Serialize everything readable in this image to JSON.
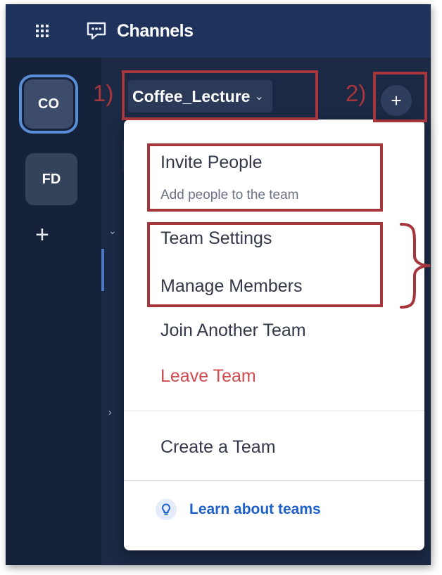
{
  "header": {
    "title": "Channels",
    "grid_icon": "app-grid-icon",
    "channels_icon": "chat-bubble-icon"
  },
  "teams": [
    {
      "initials": "CO",
      "active": true
    },
    {
      "initials": "FD",
      "active": false
    }
  ],
  "add_team_symbol": "+",
  "sidebar": {
    "team_name": "Coffee_Lecture",
    "chevron": "⌄",
    "plus_symbol": "+",
    "section_chevron_open": "⌄",
    "section_chevron_closed": "›"
  },
  "menu": {
    "invite_title": "Invite People",
    "invite_subtitle": "Add people to the team",
    "team_settings": "Team Settings",
    "manage_members": "Manage Members",
    "join_team": "Join Another Team",
    "leave_team": "Leave Team",
    "create_team": "Create a Team",
    "learn_link": "Learn about teams"
  },
  "annotations": {
    "label_1": "1)",
    "label_2": "2)"
  },
  "colors": {
    "accent": "#5b8ed8",
    "annotation": "#a7353c",
    "danger": "#d24b4e",
    "link": "#1e60c9",
    "header": "#1e325c"
  }
}
